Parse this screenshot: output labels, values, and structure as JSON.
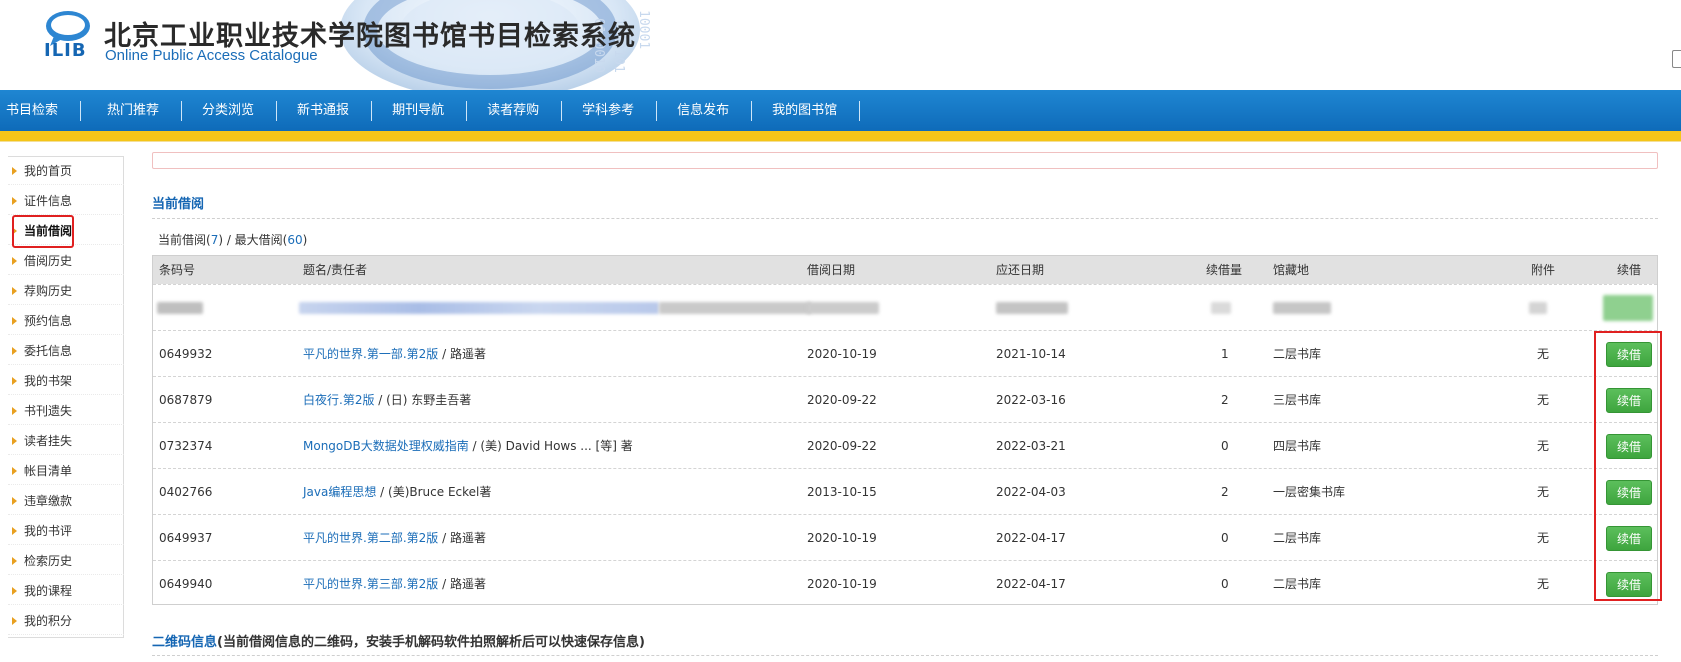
{
  "header": {
    "logo_text": "ILIB",
    "title": "北京工业职业技术学院图书馆书目检索系统",
    "subtitle": "Online Public Access Catalogue"
  },
  "nav": {
    "items": [
      "书目检索",
      "热门推荐",
      "分类浏览",
      "新书通报",
      "期刊导航",
      "读者荐购",
      "学科参考",
      "信息发布",
      "我的图书馆"
    ]
  },
  "sidebar": {
    "items": [
      "我的首页",
      "证件信息",
      "当前借阅",
      "借阅历史",
      "荐购历史",
      "预约信息",
      "委托信息",
      "我的书架",
      "书刊遗失",
      "读者挂失",
      "帐目清单",
      "违章缴款",
      "我的书评",
      "检索历史",
      "我的课程",
      "我的积分"
    ],
    "active": "当前借阅"
  },
  "main": {
    "section_title": "当前借阅",
    "count": {
      "prefix": "当前借阅(",
      "current": "7",
      "middle": ") / 最大借阅(",
      "max": "60",
      "suffix": ")"
    },
    "table": {
      "headers": [
        "条码号",
        "题名/责任者",
        "借阅日期",
        "应还日期",
        "续借量",
        "馆藏地",
        "附件",
        "续借"
      ],
      "rows": [
        {
          "barcode": "0649932",
          "title": "平凡的世界.第一部.第2版",
          "author": " / 路遥著",
          "borrow_date": "2020-10-19",
          "due_date": "2021-10-14",
          "renew_count": "1",
          "location": "二层书库",
          "attachment": "无",
          "renew_label": "续借"
        },
        {
          "barcode": "0687879",
          "title": "白夜行.第2版",
          "author": " / (日) 东野圭吾著",
          "borrow_date": "2020-09-22",
          "due_date": "2022-03-16",
          "renew_count": "2",
          "location": "三层书库",
          "attachment": "无",
          "renew_label": "续借"
        },
        {
          "barcode": "0732374",
          "title": "MongoDB大数据处理权威指南",
          "author": " / (美) David Hows ... [等] 著",
          "borrow_date": "2020-09-22",
          "due_date": "2022-03-21",
          "renew_count": "0",
          "location": "四层书库",
          "attachment": "无",
          "renew_label": "续借"
        },
        {
          "barcode": "0402766",
          "title": "Java编程思想",
          "author": " / (美)Bruce Eckel著",
          "borrow_date": "2013-10-15",
          "due_date": "2022-04-03",
          "renew_count": "2",
          "location": "一层密集书库",
          "attachment": "无",
          "renew_label": "续借"
        },
        {
          "barcode": "0649937",
          "title": "平凡的世界.第二部.第2版",
          "author": " / 路遥著",
          "borrow_date": "2020-10-19",
          "due_date": "2022-04-17",
          "renew_count": "0",
          "location": "二层书库",
          "attachment": "无",
          "renew_label": "续借"
        },
        {
          "barcode": "0649940",
          "title": "平凡的世界.第三部.第2版",
          "author": " / 路遥著",
          "borrow_date": "2020-10-19",
          "due_date": "2022-04-17",
          "renew_count": "0",
          "location": "二层书库",
          "attachment": "无",
          "renew_label": "续借"
        }
      ]
    },
    "qr": {
      "title_blue": "二维码信息",
      "title_rest": "(当前借阅信息的二维码，安装手机解码软件拍照解析后可以快速保存信息)"
    }
  },
  "colors": {
    "nav_blue": "#0e6bb9",
    "accent_yellow": "#f5c518",
    "link_blue": "#1b6db8",
    "renew_green": "#4cb44c",
    "highlight_red": "#e02020"
  }
}
